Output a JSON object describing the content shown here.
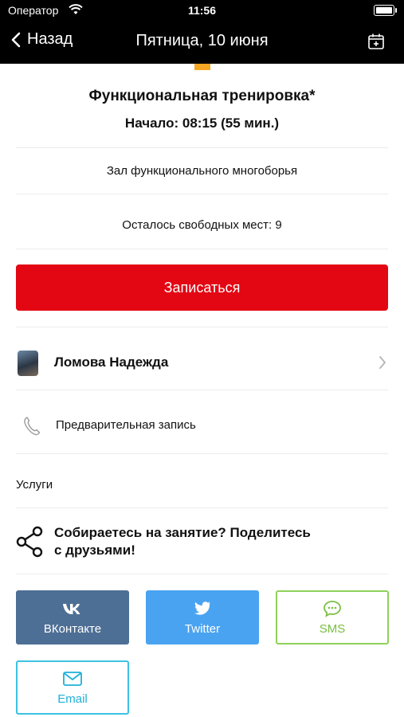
{
  "status_bar": {
    "carrier": "Оператор",
    "time": "11:56"
  },
  "nav": {
    "back_label": "Назад",
    "title": "Пятница, 10 июня"
  },
  "colors": {
    "accent": "#f5a623",
    "signup": "#e30613",
    "vk": "#4e6f95",
    "twitter": "#4aa3f0",
    "sms": "#7bc043",
    "email": "#1fb0d8"
  },
  "event": {
    "title": "Функциональная тренировка*",
    "start": "Начало: 08:15 (55 мин.)",
    "hall": "Зал функционального многоборья",
    "seats": "Осталось свободных мест: 9"
  },
  "signup_label": "Записаться",
  "trainer": {
    "name": "Ломова Надежда"
  },
  "prebook_label": "Предварительная запись",
  "services_label": "Услуги",
  "share": {
    "line1": "Собираетесь на занятие? Поделитесь",
    "line2": "с друзьями!",
    "buttons": {
      "vk": "ВКонтакте",
      "twitter": "Twitter",
      "sms": "SMS",
      "email": "Email"
    }
  },
  "icons": [
    "wifi-icon",
    "battery-icon",
    "back-chevron-icon",
    "calendar-add-icon",
    "chevron-right-icon",
    "phone-icon",
    "share-icon",
    "vk-icon",
    "twitter-icon",
    "sms-icon",
    "email-icon"
  ]
}
